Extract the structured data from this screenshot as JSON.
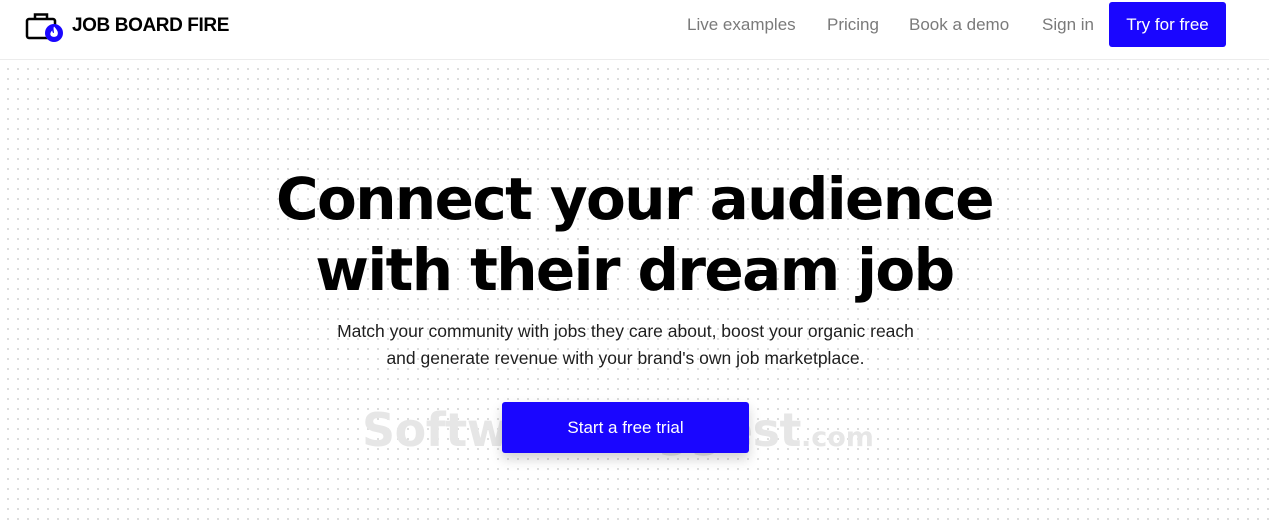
{
  "brand": {
    "name": "JOB BOARD FIRE",
    "logo_icon": "briefcase-flame-icon",
    "accent_color": "#1a06ff"
  },
  "nav": {
    "items": [
      {
        "label": "Live examples"
      },
      {
        "label": "Pricing"
      },
      {
        "label": "Book a demo"
      },
      {
        "label": "Sign in"
      }
    ],
    "cta_label": "Try for free"
  },
  "hero": {
    "headline_lines": [
      "Connect your audience",
      "with their dream job"
    ],
    "subtext_lines": [
      "Match your community with jobs they care about, boost your organic reach",
      "and generate revenue with your brand's own job marketplace."
    ],
    "cta_label": "Start a free trial"
  },
  "watermark": {
    "main": "SoftwareSuggest",
    "tld": ".com"
  },
  "colors": {
    "primary": "#1a06ff",
    "nav_text": "#7a7a7a",
    "heading": "#000000"
  }
}
